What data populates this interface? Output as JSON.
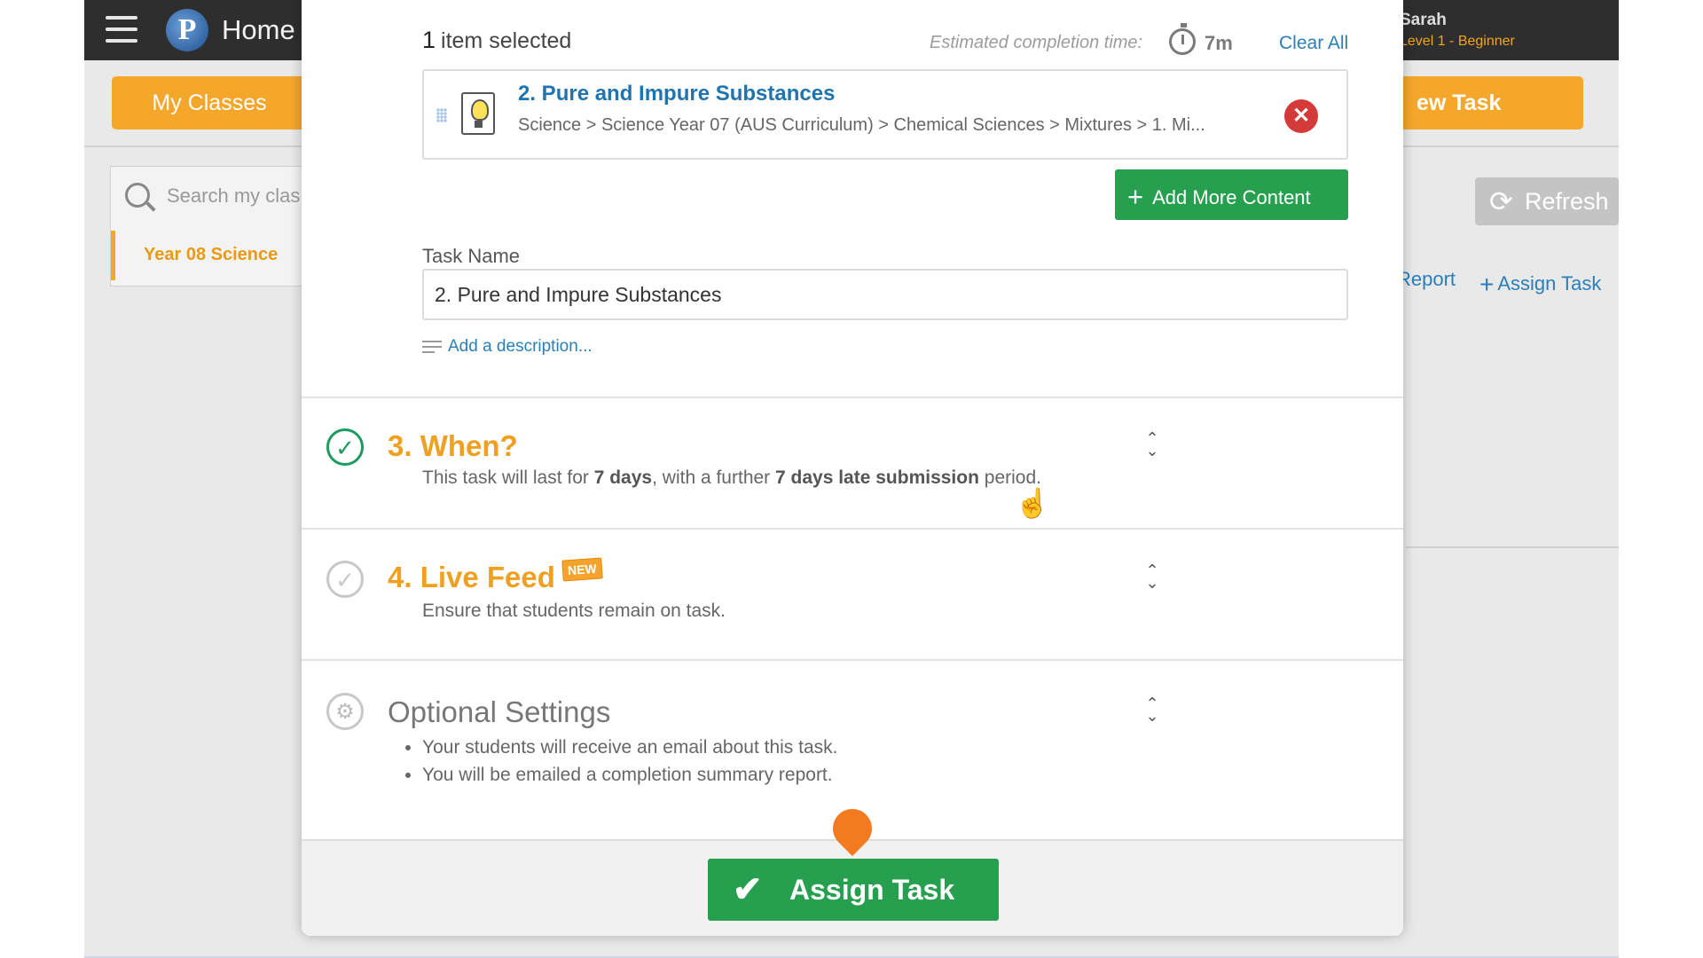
{
  "app": {
    "home_title": "Home",
    "logo_letter": "P",
    "user_name": "Sarah",
    "user_level": "Level 1 - Beginner",
    "my_classes": "My Classes",
    "new_task": "ew Task",
    "search_placeholder": "Search my clas",
    "class_item": "Year 08 Science",
    "refresh": "Refresh",
    "report": "Report",
    "assign_task_link": "Assign Task"
  },
  "modal": {
    "items_count": "1",
    "items_label": "item selected",
    "est_label": "Estimated completion time:",
    "est_value": "7m",
    "clear_all": "Clear All",
    "content": {
      "title": "2. Pure and Impure Substances",
      "path": "Science > Science Year 07 (AUS Curriculum) > Chemical Sciences > Mixtures > 1. Mi..."
    },
    "add_more_content": "Add More Content",
    "task_name_label": "Task Name",
    "task_name_value": "2. Pure and Impure Substances",
    "add_description": "Add a description...",
    "when": {
      "title": "3. When?",
      "sub_pre": "This task will last for ",
      "sub_days": "7 days",
      "sub_mid": ", with a further ",
      "sub_late": "7 days late submission",
      "sub_post": " period."
    },
    "live_feed": {
      "title": "4. Live Feed",
      "badge": "NEW",
      "sub": "Ensure that students remain on task."
    },
    "optional": {
      "title": "Optional Settings",
      "items": [
        "Your students will receive an email about this task.",
        "You will be emailed a completion summary report."
      ]
    },
    "assign_button": "Assign Task"
  },
  "colors": {
    "accent_orange": "#f4a72b",
    "primary_green": "#26a04f",
    "link_blue": "#2a7fb8",
    "danger_red": "#d53a3a"
  },
  "icons": [
    "menu-icon",
    "search-icon",
    "refresh-icon",
    "timer-icon",
    "bulb-icon",
    "close-icon",
    "plus-icon",
    "check-icon",
    "gear-icon",
    "expand-icon",
    "cursor-icon"
  ]
}
